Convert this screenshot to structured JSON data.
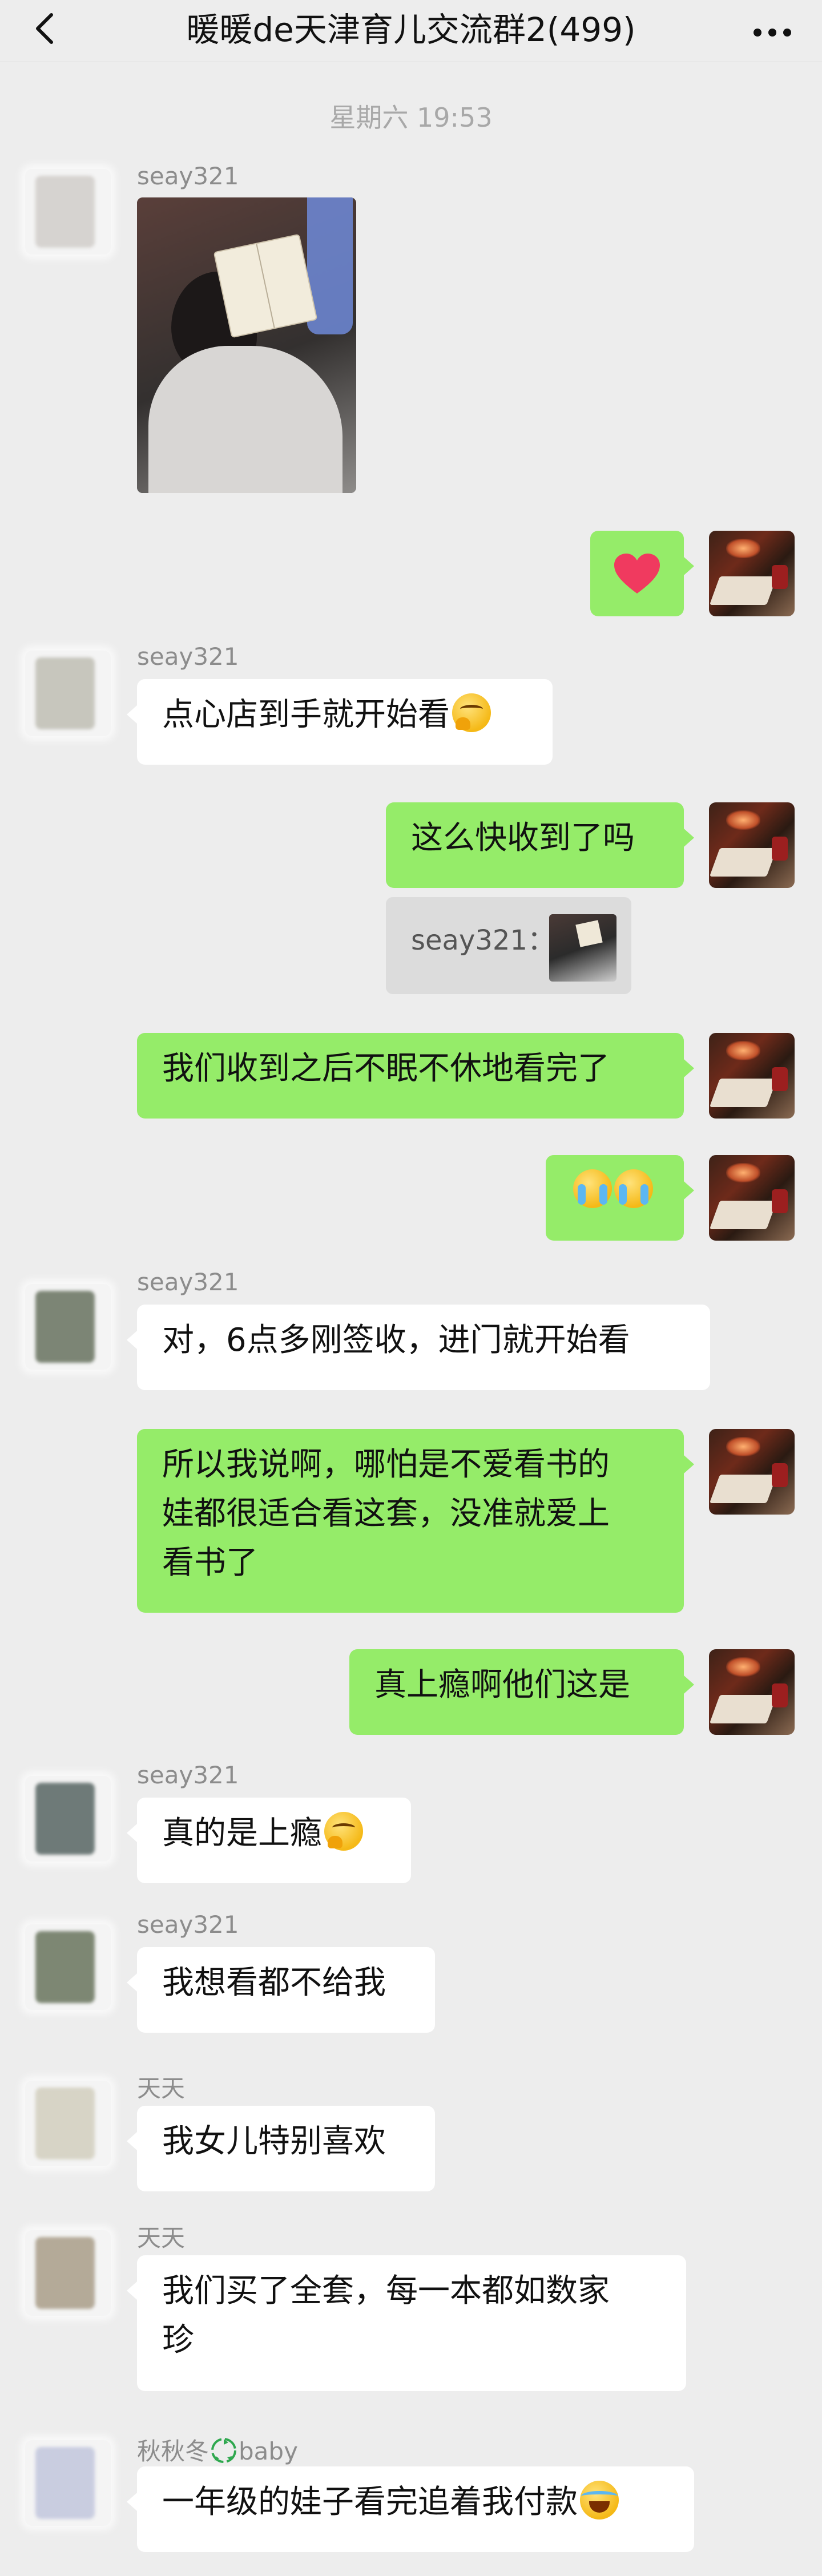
{
  "header": {
    "title": "暖暖de天津育儿交流群2(499)"
  },
  "timestamp": "星期六 19:53",
  "colors": {
    "self_bubble": "#95ec69",
    "other_bubble": "#ffffff",
    "background": "#ededed"
  },
  "messages": {
    "m1": {
      "sender": "seay321",
      "type": "image",
      "image_label": "photo of child reading a book"
    },
    "m2": {
      "type": "emoji",
      "emoji": "heart-emoji"
    },
    "m3": {
      "sender": "seay321",
      "text": "点心店到手就开始看",
      "emoji": "thinking-face-emoji"
    },
    "m4": {
      "text": "这么快收到了吗",
      "quote_text": "seay321："
    },
    "m5": {
      "text": "我们收到之后不眠不休地看完了"
    },
    "m6": {
      "type": "emoji",
      "emoji": "crying-face-emoji"
    },
    "m7": {
      "sender": "seay321",
      "text": "对，6点多刚签收，进门就开始看"
    },
    "m8": {
      "line1": "所以我说啊，哪怕是不爱看书的",
      "line2": "娃都很适合看这套，没准就爱上",
      "line3": "看书了"
    },
    "m9": {
      "text": "真上瘾啊他们这是"
    },
    "m10": {
      "sender": "seay321",
      "text": "真的是上瘾",
      "emoji": "thinking-face-emoji"
    },
    "m11": {
      "sender": "seay321",
      "text": "我想看都不给我"
    },
    "m12": {
      "sender": "天天",
      "text": "我女儿特别喜欢"
    },
    "m13": {
      "sender": "天天",
      "line1": "我们买了全套，每一本都如数家",
      "line2": "珍"
    },
    "m14": {
      "sender_prefix": "秋秋冬",
      "sender_suffix": "baby",
      "sender_icon": "recycle-icon",
      "text": "一年级的娃子看完追着我付款",
      "emoji": "tears-of-joy-emoji"
    }
  }
}
